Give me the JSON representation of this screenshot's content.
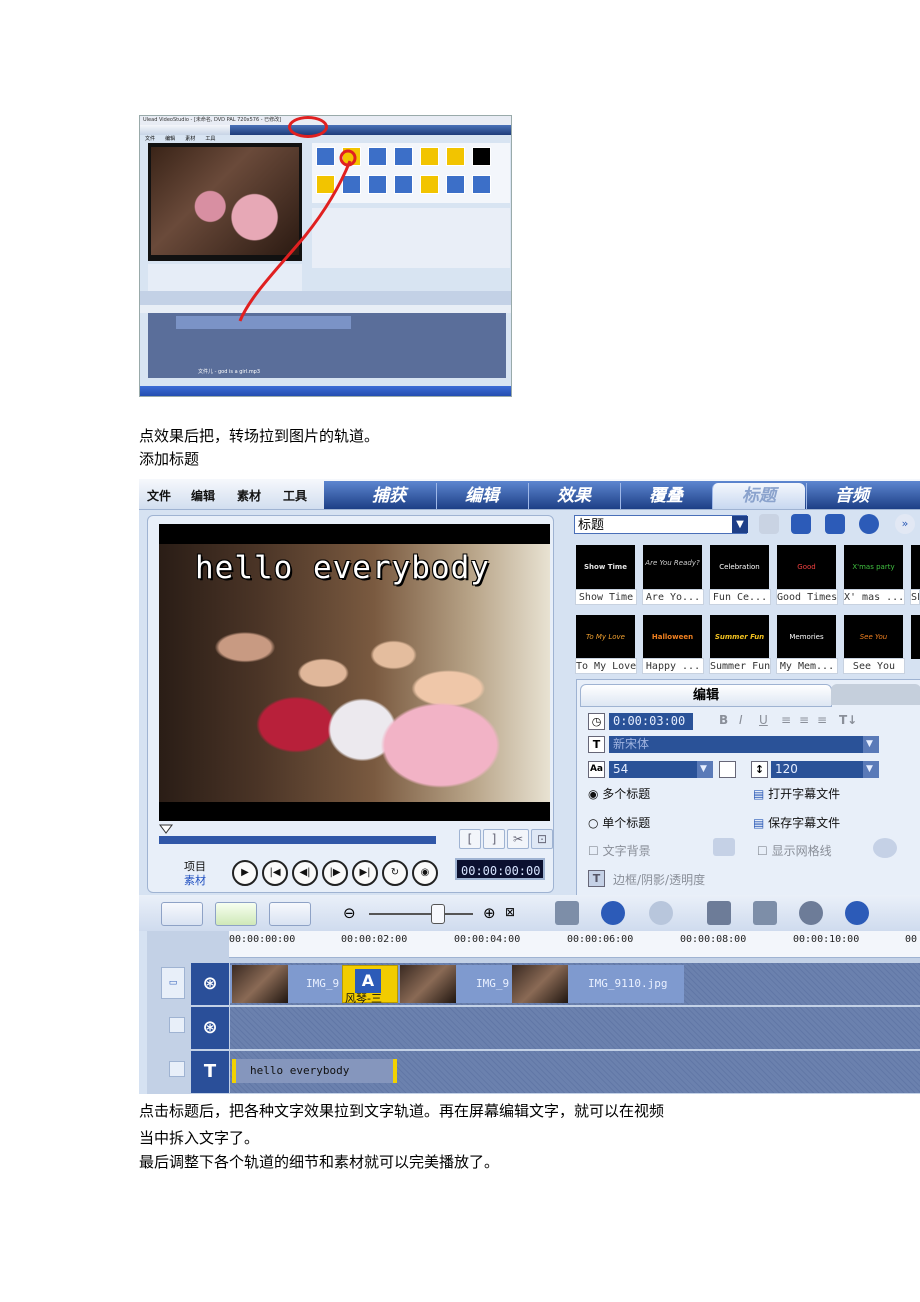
{
  "screenshot1": {
    "title_bar": "Ulead VideoStudio - [未命名, DVD PAL 720x576 - 已修改]",
    "menu_items": [
      "文件",
      "编辑",
      "素材",
      "工具"
    ],
    "audio_clip": "文件儿 - god is a girl.mp3"
  },
  "paragraph1": "点效果后把，转场拉到图片的轨道。",
  "paragraph2": "添加标题",
  "screenshot2": {
    "menu_items": [
      "文件",
      "编辑",
      "素材",
      "工具"
    ],
    "tabs": [
      "捕获",
      "编辑",
      "效果",
      "覆叠",
      "标题",
      "音频"
    ],
    "active_tab": "标题",
    "preview_overlay_text": "hello everybody",
    "project_label": "项目",
    "clip_label": "素材",
    "preview_timecode": "00:00:00:00",
    "library_dropdown": "标题",
    "title_presets_row1": [
      "Show Time",
      "Are Yo...",
      "Fun Ce...",
      "Good Times",
      "X' mas ...",
      "SF"
    ],
    "title_presets_row2": [
      "To My Love",
      "Happy ...",
      "Summer Fun",
      "My Mem...",
      "See You",
      ""
    ],
    "edit_tab": "编辑",
    "duration": "0:00:03:00",
    "font": "新宋体",
    "font_size": "54",
    "line_spacing": "120",
    "multi_title": "多个标题",
    "single_title": "单个标题",
    "multi_title_selected": true,
    "open_subtitle": "打开字幕文件",
    "save_subtitle": "保存字幕文件",
    "text_background": "文字背景",
    "show_grid": "显示网格线",
    "border_shadow": "边框/阴影/透明度",
    "ruler_ticks": [
      "00:00:00:00",
      "00:00:02:00",
      "00:00:04:00",
      "00:00:06:00",
      "00:00:08:00",
      "00:00:10:00",
      "00"
    ],
    "clips": [
      "IMG_9",
      "IMG_9",
      "IMG_9110.jpg"
    ],
    "transition_label": "风琴-三",
    "title_clip": "hello everybody",
    "track_icons": [
      "video-track-icon",
      "overlay-track-icon",
      "title-track-icon"
    ],
    "colors": {
      "tab_bar": "#1d3f86",
      "timecode_bg": "#0b1030",
      "track_header": "#2a4f99",
      "title_clip_border": "#f2d200"
    }
  },
  "paragraph3_line1": "点击标题后，把各种文字效果拉到文字轨道。再在屏幕编辑文字，就可以在视频",
  "paragraph3_line2": "当中拆入文字了。",
  "paragraph4": "最后调整下各个轨道的细节和素材就可以完美播放了。"
}
